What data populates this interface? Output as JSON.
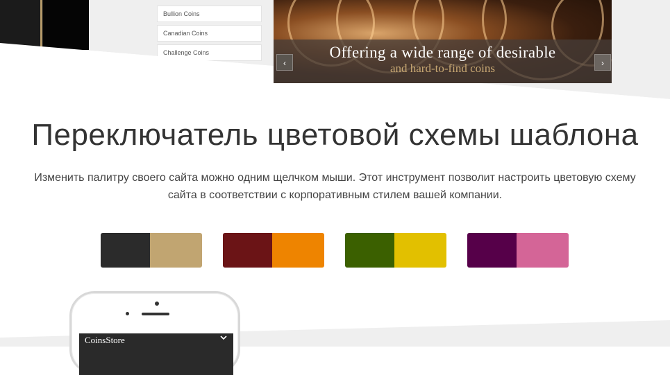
{
  "categories": [
    {
      "label": "Bullion Coins"
    },
    {
      "label": "Canadian Coins"
    },
    {
      "label": "Challenge Coins"
    }
  ],
  "slider": {
    "caption_line1": "Offering a wide range of desirable",
    "caption_line2": "and hard-to-find coins",
    "prev_icon": "‹",
    "next_icon": "›"
  },
  "section": {
    "title": "Переключатель цветовой схемы шаблона",
    "description": "Изменить палитру своего сайта можно одним щелчком мыши. Этот инструмент позволит настроить цветовую схему сайта в соответствии с корпоративным стилем вашей компании."
  },
  "color_schemes": [
    {
      "primary": "#2b2b2b",
      "secondary": "#c1a571"
    },
    {
      "primary": "#6b1416",
      "secondary": "#ee8400"
    },
    {
      "primary": "#3b6000",
      "secondary": "#e2c000"
    },
    {
      "primary": "#560049",
      "secondary": "#d46597"
    }
  ],
  "phone": {
    "store_name": "CoinsStore",
    "menu_icon": "chevron-down-icon"
  }
}
